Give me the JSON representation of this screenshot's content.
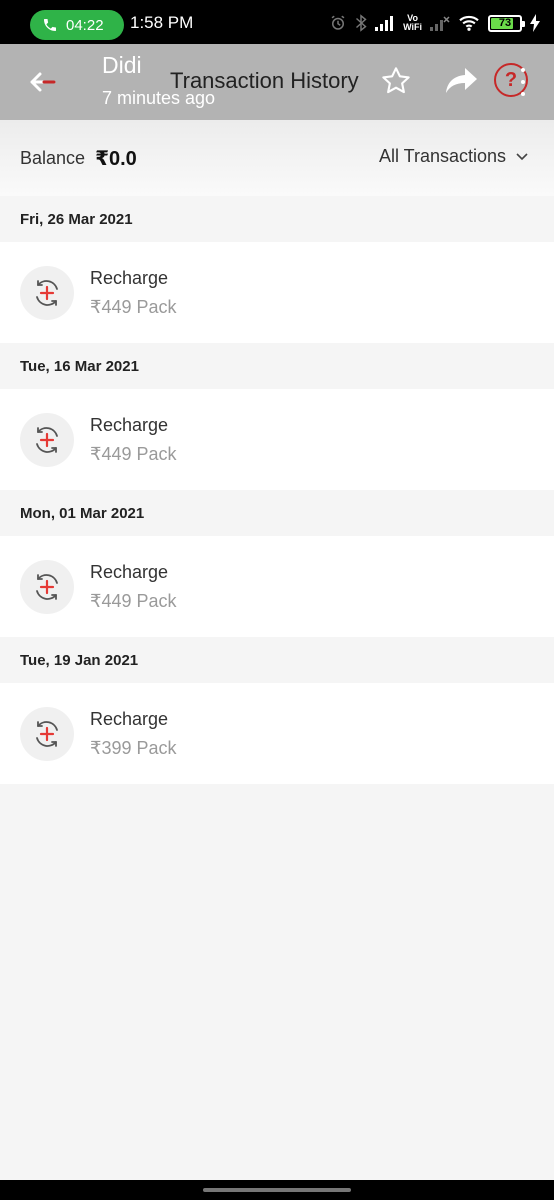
{
  "status_bar": {
    "call_timer": "04:22",
    "time": "1:58 PM",
    "network_label_top": "Vo",
    "network_label_bottom": "WiFi",
    "battery": "73",
    "battery_level_percent": 73,
    "call_pill_color": "#2fb348",
    "battery_color": "#6bdc4a"
  },
  "header": {
    "contact_name": "Didi",
    "contact_subtitle": "7 minutes ago",
    "title": "Transaction History",
    "help_label": "?",
    "icons": [
      "back-arrow-icon",
      "star-icon",
      "share-icon",
      "help-icon",
      "more-icon"
    ]
  },
  "balance": {
    "label": "Balance",
    "value": "₹0.0",
    "filter_label": "All Transactions"
  },
  "transactions": [
    {
      "date": "Fri, 26 Mar 2021",
      "title": "Recharge",
      "pack": "₹449 Pack"
    },
    {
      "date": "Tue, 16 Mar 2021",
      "title": "Recharge",
      "pack": "₹449 Pack"
    },
    {
      "date": "Mon, 01 Mar 2021",
      "title": "Recharge",
      "pack": "₹449 Pack"
    },
    {
      "date": "Tue, 19 Jan 2021",
      "title": "Recharge",
      "pack": "₹399 Pack"
    }
  ],
  "colors": {
    "header_bg": "#b3b3b3",
    "accent_red": "#c62828",
    "recharge_plus": "#e53935"
  }
}
